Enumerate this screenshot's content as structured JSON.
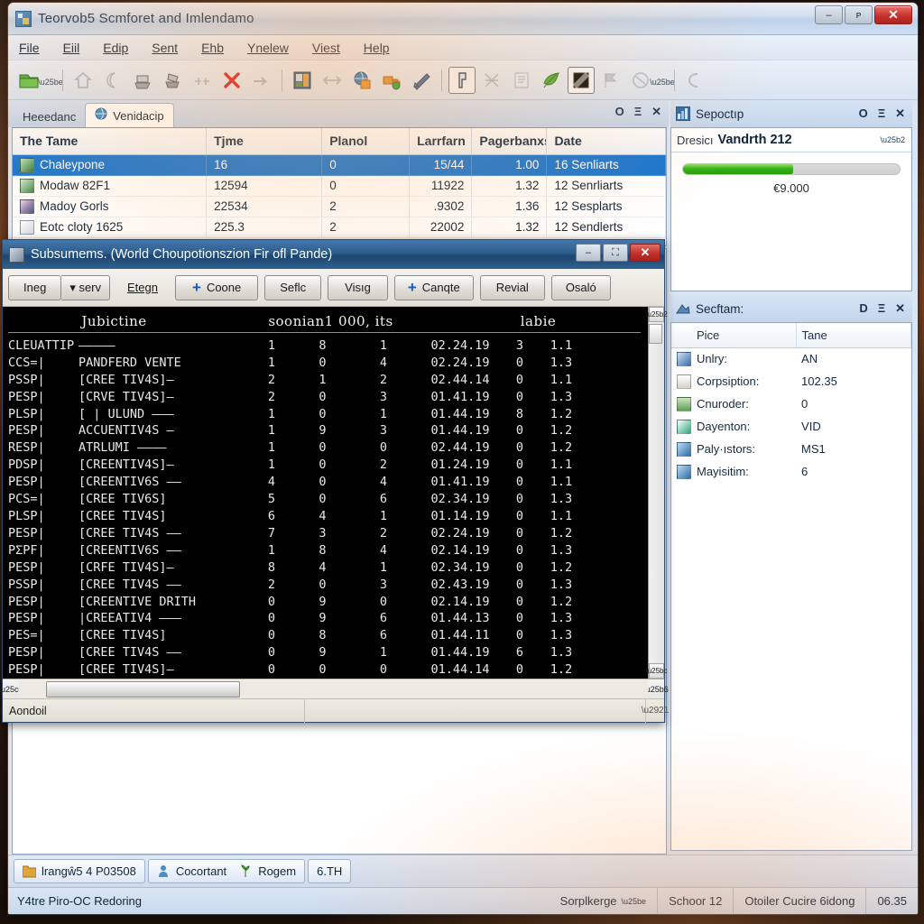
{
  "window": {
    "title": "Teorvob5 Scmforet and Imlendamo",
    "icon": "app-icon",
    "buttons": {
      "minimize": "–",
      "restore": "ᴘ",
      "close": "✕"
    }
  },
  "menubar": {
    "items": [
      {
        "label": "File"
      },
      {
        "label": "Eiil"
      },
      {
        "label": "Edip"
      },
      {
        "label": "Sent"
      },
      {
        "label": "Ehb"
      },
      {
        "label": "Ynelew"
      },
      {
        "label": "Viest"
      },
      {
        "label": "Help"
      }
    ]
  },
  "toolbar": {
    "icons": [
      "open-folder-icon",
      "dropdown-caret-icon",
      "home-icon",
      "moon-icon",
      "print-icon",
      "scan-icon",
      "link-icon",
      "delete-x-icon",
      "arrow-right-icon",
      "photo-icon",
      "sync-icon",
      "globe-icon",
      "truck-icon",
      "page-icon",
      "flag-icon",
      "cut-icon",
      "list-icon",
      "leaf-icon",
      "monitor-icon",
      "play-flag-icon",
      "no-entry-icon",
      "chevron-down-icon",
      "curve-icon"
    ]
  },
  "left_pane": {
    "tabs": [
      {
        "label": "Heeedanc",
        "active": false,
        "icon": null
      },
      {
        "label": "Venidacip",
        "active": true,
        "icon": "globe-tab-icon"
      }
    ],
    "head_buttons": [
      "O",
      "Ξ",
      "✕"
    ],
    "grid": {
      "columns": [
        "The Tame",
        "Tjme",
        "Planol",
        "Larrfarn",
        "Pagerbanxs",
        "Date"
      ],
      "rows": [
        {
          "selected": true,
          "icon_color": "#2f7d3a",
          "cells": [
            "Chaleypone",
            "16",
            "0",
            "15/44",
            "1.00",
            "16 Senliarts"
          ]
        },
        {
          "selected": false,
          "icon_color": "#3d8b4a",
          "cells": [
            "Modaw 82F1",
            "12594",
            "0",
            "11922",
            "1.32",
            "12 Senrliarts"
          ]
        },
        {
          "selected": false,
          "icon_color": "#8a7ba8",
          "cells": [
            "Madoy Gorls",
            "22534",
            "2",
            ".9302",
            "1.36",
            "12 Sesplarts"
          ]
        },
        {
          "selected": false,
          "icon_color": "#cfd8e4",
          "cells": [
            "Eotc cloty 1625",
            "225.3",
            "2",
            "22002",
            "1.32",
            "12 Sendlerts"
          ]
        }
      ]
    }
  },
  "child_window": {
    "title": "Subsumems. (World Choupotionszion Fir ofl Pande)",
    "icon": "child-app-icon",
    "buttons": {
      "minimize": "–",
      "restore": "⛶",
      "close": "✕"
    },
    "toolbar": [
      {
        "label": "Ineg",
        "kind": "button"
      },
      {
        "label": "▾ serv",
        "kind": "split"
      },
      {
        "label": "Etegn",
        "kind": "link"
      },
      {
        "label": "Coone",
        "kind": "button",
        "plus": true
      },
      {
        "label": "Seflc",
        "kind": "button"
      },
      {
        "label": "Visıg",
        "kind": "button"
      },
      {
        "label": "Canqte",
        "kind": "button",
        "plus": true
      },
      {
        "label": "Revial",
        "kind": "button"
      },
      {
        "label": "Osaló",
        "kind": "button"
      }
    ],
    "console": {
      "header": [
        "Jubictine",
        "soonian1 000, its",
        "labie"
      ],
      "rows": [
        {
          "a": "CLEUATTIP",
          "b": "—————",
          "c": "1",
          "d": "8",
          "e": "1",
          "f": "02.24.19",
          "g": "3",
          "h": "1.1"
        },
        {
          "a": "CCS=|",
          "b": "PANDFERD VENTE",
          "c": "1",
          "d": "0",
          "e": "4",
          "f": "02.24.19",
          "g": "0",
          "h": "1.3"
        },
        {
          "a": "PSSP|",
          "b": "[CREE TIV4S]—",
          "c": "2",
          "d": "1",
          "e": "2",
          "f": "02.44.14",
          "g": "0",
          "h": "1.1"
        },
        {
          "a": "PESP|",
          "b": "[CRVE TIV4S]—",
          "c": "2",
          "d": "0",
          "e": "3",
          "f": "01.41.19",
          "g": "0",
          "h": "1.3"
        },
        {
          "a": "PLSP|",
          "b": "[ | ULUND ———",
          "c": "1",
          "d": "0",
          "e": "1",
          "f": "01.44.19",
          "g": "8",
          "h": "1.2"
        },
        {
          "a": "PESP|",
          "b": "ACCUENTIV4S —",
          "c": "1",
          "d": "9",
          "e": "3",
          "f": "01.44.19",
          "g": "0",
          "h": "1.2"
        },
        {
          "a": "RESP|",
          "b": "ATRLUMI ————",
          "c": "1",
          "d": "0",
          "e": "0",
          "f": "02.44.19",
          "g": "0",
          "h": "1.2"
        },
        {
          "a": "PDSP|",
          "b": "[CREENTIV4S]—",
          "c": "1",
          "d": "0",
          "e": "2",
          "f": "01.24.19",
          "g": "0",
          "h": "1.1"
        },
        {
          "a": "PESP|",
          "b": "[CREENTIV6S ——",
          "c": "4",
          "d": "0",
          "e": "4",
          "f": "01.41.19",
          "g": "0",
          "h": "1.1"
        },
        {
          "a": "PCS=|",
          "b": "[CREE TIV6S]",
          "c": "5",
          "d": "0",
          "e": "6",
          "f": "02.34.19",
          "g": "0",
          "h": "1.3"
        },
        {
          "a": "PLSP|",
          "b": "[CREE TIV4S]",
          "c": "6",
          "d": "4",
          "e": "1",
          "f": "01.14.19",
          "g": "0",
          "h": "1.1"
        },
        {
          "a": "PESP|",
          "b": "[CREE TIV4S ——",
          "c": "7",
          "d": "3",
          "e": "2",
          "f": "02.24.19",
          "g": "0",
          "h": "1.2"
        },
        {
          "a": "PΣPF|",
          "b": "[CREENTIV6S ——",
          "c": "1",
          "d": "8",
          "e": "4",
          "f": "02.14.19",
          "g": "0",
          "h": "1.3"
        },
        {
          "a": "PESP|",
          "b": "[CRFE TIV4S]—",
          "c": "8",
          "d": "4",
          "e": "1",
          "f": "02.34.19",
          "g": "0",
          "h": "1.2"
        },
        {
          "a": "PSSP|",
          "b": "[CREE TIV4S ——",
          "c": "2",
          "d": "0",
          "e": "3",
          "f": "02.43.19",
          "g": "0",
          "h": "1.3"
        },
        {
          "a": "PESP|",
          "b": "[CREENTIVE DRITH",
          "c": "0",
          "d": "9",
          "e": "0",
          "f": "02.14.19",
          "g": "0",
          "h": "1.2"
        },
        {
          "a": "PESP|",
          "b": "|CREEATIV4 ———",
          "c": "0",
          "d": "9",
          "e": "6",
          "f": "01.44.13",
          "g": "0",
          "h": "1.3"
        },
        {
          "a": "PES=|",
          "b": "[CREE TIV4S]",
          "c": "0",
          "d": "8",
          "e": "6",
          "f": "01.44.11",
          "g": "0",
          "h": "1.3"
        },
        {
          "a": "PESP|",
          "b": "[CREE TIV4S ——",
          "c": "0",
          "d": "9",
          "e": "1",
          "f": "01.44.19",
          "g": "6",
          "h": "1.3"
        },
        {
          "a": "PESP|",
          "b": "[CREE TIV4S]—",
          "c": "0",
          "d": "0",
          "e": "0",
          "f": "01.44.14",
          "g": "0",
          "h": "1.2"
        }
      ]
    },
    "status": {
      "label": "Aondoil"
    }
  },
  "right_panels": {
    "progress_panel": {
      "title": "Sepoctıp",
      "icon": "chart-panel-icon",
      "head_buttons": [
        "O",
        "Ξ",
        "✕"
      ],
      "item_label_prefix": "Dresicı",
      "item_label_main": "Vandrth 212",
      "progress_percent": 51,
      "value_label": "€9.000",
      "bar_color": "#35b212"
    },
    "properties_panel": {
      "title": "Secftam:",
      "icon": "props-panel-icon",
      "head_buttons": [
        "D",
        "Ξ",
        "✕"
      ],
      "columns": [
        "Pice",
        "Tane"
      ],
      "rows": [
        {
          "icon": "pen-icon",
          "icon_color": "#3a6fae",
          "key": "Unlry:",
          "value": "AN"
        },
        {
          "icon": "doc-icon",
          "icon_color": "#d6d2c6",
          "key": "Corpsiption:",
          "value": "102.35"
        },
        {
          "icon": "printer-icon",
          "icon_color": "#5f9e53",
          "key": "Cnuroder:",
          "value": "0"
        },
        {
          "icon": "brush-icon",
          "icon_color": "#2ea87d",
          "key": "Dayenton:",
          "value": "VID"
        },
        {
          "icon": "globe-icon",
          "icon_color": "#4e8fc4",
          "key": "Paly·ıstors:",
          "value": "MS1"
        },
        {
          "icon": "globe2-icon",
          "icon_color": "#4e8fc4",
          "key": "Mayisitim:",
          "value": "6"
        }
      ]
    }
  },
  "taskstrip": {
    "buttons": [
      {
        "label": "lrangŵ5 4 P03508",
        "icon": "folder-task-icon",
        "icon_color": "#e0a63a"
      },
      {
        "label": "Cocortant",
        "icon": "person-task-icon",
        "icon_color": "#4b8ec6"
      },
      {
        "label": "Rogem",
        "icon": "plant-task-icon",
        "icon_color": "#5fae4e"
      },
      {
        "label": "6.TH",
        "icon": null,
        "icon_color": null
      }
    ]
  },
  "statusbar": {
    "left": "Y4tre Piro-OC Redoring",
    "cells": [
      {
        "label": "Sorplkerge",
        "caret": true
      },
      {
        "label": "Sсhoor 12",
        "caret": false
      },
      {
        "label": "Otoiler Cucire 6idong",
        "caret": false
      },
      {
        "label": "06.35",
        "caret": false
      }
    ]
  }
}
